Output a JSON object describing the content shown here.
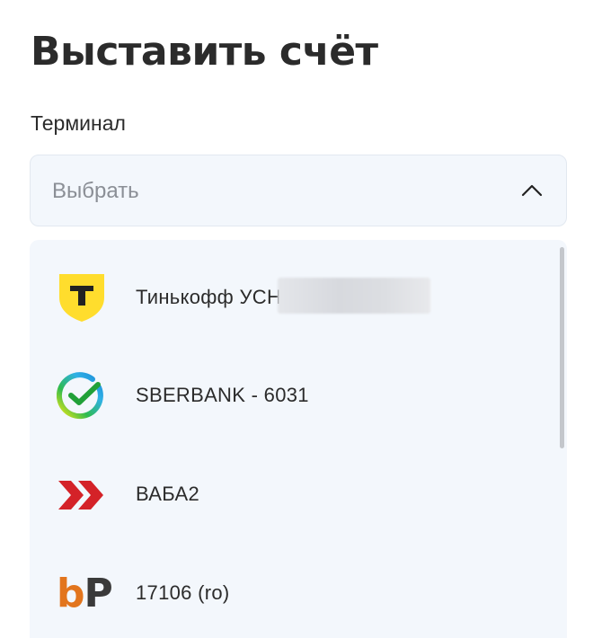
{
  "page": {
    "title": "Выставить счёт"
  },
  "terminal_field": {
    "label": "Терминал",
    "placeholder": "Выбрать",
    "expanded": true
  },
  "options": [
    {
      "label": "Тинькофф УСН",
      "icon": "tinkoff-shield-icon",
      "label_partially_redacted": true
    },
    {
      "label": "SBERBANK - 6031",
      "icon": "sberbank-logo-icon"
    },
    {
      "label": "ВАБА2",
      "icon": "double-chevron-logo-icon"
    },
    {
      "label": "17106 (ro)",
      "icon": "bp-logo-icon",
      "icon_text_b": "b",
      "icon_text_p": "P"
    }
  ],
  "colors": {
    "tinkoff_yellow": "#ffdd2d",
    "sber_green": "#21a038",
    "red_chevrons": "#d42228",
    "bp_orange": "#e2751d",
    "panel_bg": "#f3f7fc"
  }
}
